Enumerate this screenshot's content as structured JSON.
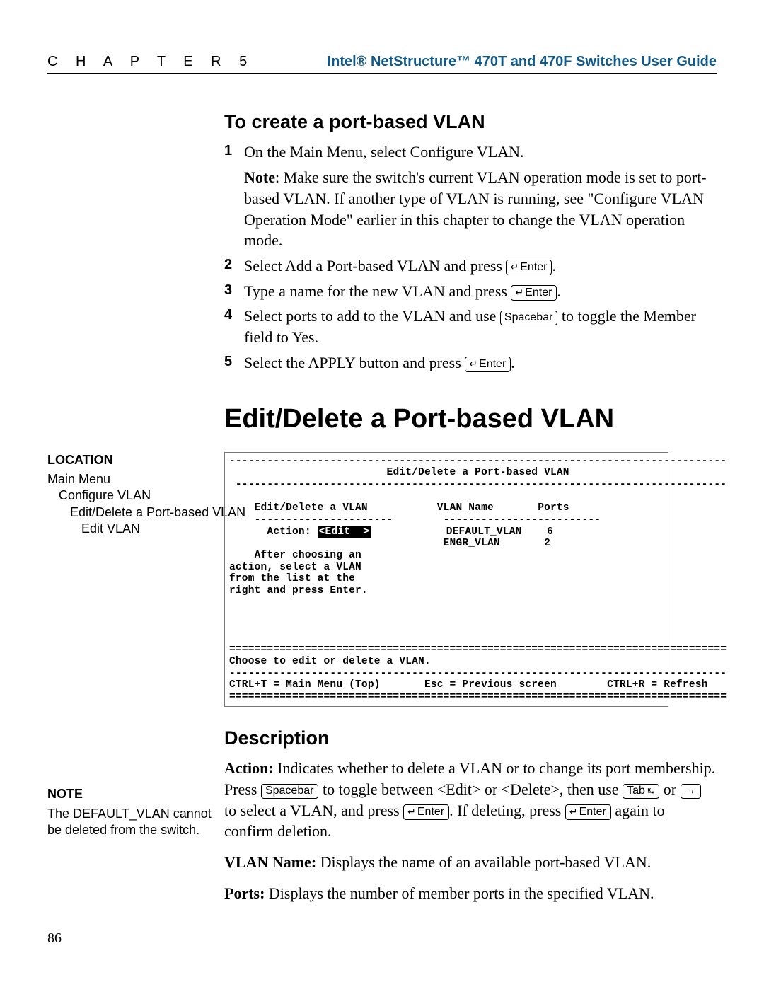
{
  "header": {
    "chapter_label": "C H A P T E R   5",
    "guide_title": "Intel® NetStructure™ 470T and 470F Switches User Guide"
  },
  "create_vlan": {
    "title": "To create a port-based VLAN",
    "steps": [
      {
        "num": "1",
        "text": "On the Main Menu, select Configure VLAN.",
        "note_bold": "Note",
        "note": ": Make sure the switch's current VLAN operation mode is set to port-based VLAN. If another type of VLAN is running, see \"Configure VLAN Operation Mode\" earlier in this chapter to change the VLAN operation mode."
      },
      {
        "num": "2",
        "text_pre": "Select Add a Port-based VLAN and press ",
        "key": "Enter",
        "text_post": "."
      },
      {
        "num": "3",
        "text_pre": "Type a name for the new VLAN and press ",
        "key": "Enter",
        "text_post": "."
      },
      {
        "num": "4",
        "text_pre": "Select ports to add to the VLAN and use ",
        "key": "Spacebar",
        "text_post": " to toggle the Member field to Yes."
      },
      {
        "num": "5",
        "text_pre": "Select the APPLY button and press ",
        "key": "Enter",
        "text_post": "."
      }
    ]
  },
  "edit_delete": {
    "title": "Edit/Delete a Port-based VLAN"
  },
  "location": {
    "head": "LOCATION",
    "items": [
      "Main Menu",
      "Configure VLAN",
      "Edit/Delete a Port-based VLAN",
      "Edit VLAN"
    ]
  },
  "terminal": {
    "title": "Edit/Delete a Port-based VLAN",
    "left_head": "Edit/Delete a VLAN",
    "action_label": "Action:",
    "action_value": "<Edit  >",
    "hint": "After choosing an\naction, select a VLAN\nfrom the list at the\nright and press Enter.",
    "col1": "VLAN Name",
    "col2": "Ports",
    "rows": [
      {
        "name": "DEFAULT_VLAN",
        "ports": "6"
      },
      {
        "name": "ENGR_VLAN",
        "ports": "2"
      }
    ],
    "status": "Choose to edit or delete a VLAN.",
    "foot_left": "CTRL+T = Main Menu (Top)",
    "foot_mid": "Esc = Previous screen",
    "foot_right": "CTRL+R = Refresh"
  },
  "description": {
    "title": "Description",
    "action_label": "Action:",
    "action_text1": " Indicates whether to delete a VLAN or to change its port membership. Press ",
    "action_key1": "Spacebar",
    "action_text2": " to toggle between <Edit> or <Delete>, then use ",
    "action_key2a": "Tab",
    "action_or": " or ",
    "action_key2b": "→",
    "action_text3": " to select a VLAN, and press ",
    "action_key3": "Enter",
    "action_text4": ". If deleting, press ",
    "action_key4": "Enter",
    "action_text5": " again to confirm deletion.",
    "vlan_label": "VLAN Name:",
    "vlan_text": " Displays the name of an available port-based VLAN.",
    "ports_label": "Ports:",
    "ports_text": " Displays the number of member ports in the specified VLAN."
  },
  "note": {
    "head": "NOTE",
    "text": "The DEFAULT_VLAN cannot be deleted from the switch."
  },
  "page_number": "86"
}
